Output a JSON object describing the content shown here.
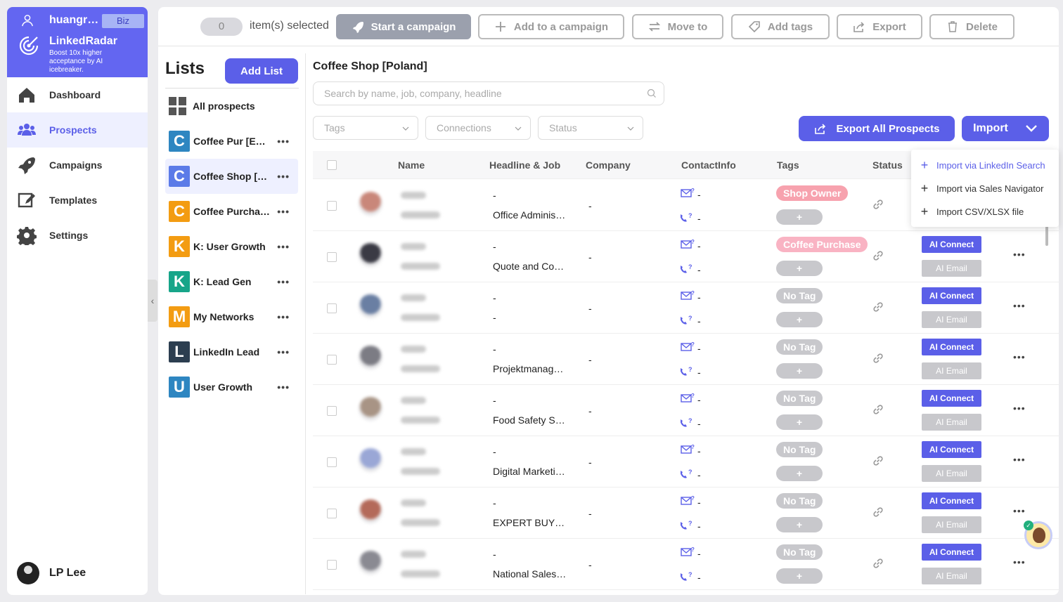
{
  "nav": {
    "username": "huangr…",
    "plan": "Biz",
    "brand": "LinkedRadar",
    "tagline": "Boost 10x higher acceptance by AI icebreaker.",
    "items": [
      {
        "label": "Dashboard"
      },
      {
        "label": "Prospects"
      },
      {
        "label": "Campaigns"
      },
      {
        "label": "Templates"
      },
      {
        "label": "Settings"
      }
    ],
    "footer_user": "LP Lee"
  },
  "toolbar": {
    "selected_count": "0",
    "selected_text": "item(s) selected",
    "start_campaign": "Start a campaign",
    "add_to_campaign": "Add to a campaign",
    "move_to": "Move to",
    "add_tags": "Add tags",
    "export": "Export",
    "delete": "Delete"
  },
  "lists": {
    "title": "Lists",
    "add_label": "Add List",
    "all_prospects": "All prospects",
    "items": [
      {
        "letter": "C",
        "name": "Coffee Pur [E…",
        "color": "#2e86c1"
      },
      {
        "letter": "C",
        "name": "Coffee Shop […",
        "color": "#5b7be8"
      },
      {
        "letter": "C",
        "name": "Coffee Purcha…",
        "color": "#f39c12"
      },
      {
        "letter": "K",
        "name": "K: User Growth",
        "color": "#f39c12"
      },
      {
        "letter": "K",
        "name": "K: Lead Gen",
        "color": "#17a589"
      },
      {
        "letter": "M",
        "name": "My Networks",
        "color": "#f39c12"
      },
      {
        "letter": "L",
        "name": "LinkedIn Lead",
        "color": "#2c3e50"
      },
      {
        "letter": "U",
        "name": "User Growth",
        "color": "#2e86c1"
      }
    ]
  },
  "content": {
    "title": "Coffee Shop [Poland]",
    "search_placeholder": "Search by name, job, company, headline",
    "filters": {
      "tags": "Tags",
      "connections": "Connections",
      "status": "Status"
    },
    "export_all": "Export All Prospects",
    "import": "Import"
  },
  "table": {
    "headers": {
      "name": "Name",
      "headline": "Headline & Job",
      "company": "Company",
      "contact": "ContactInfo",
      "tags": "Tags",
      "status": "Status"
    },
    "rows": [
      {
        "dash": "-",
        "job": "Office Adminis…",
        "company": "-",
        "email": "-",
        "phone": "-",
        "tag": "Shop Owner",
        "tagType": "pink",
        "plus": "+",
        "ai_connect": "",
        "ai_email": "",
        "avatarColor": "#c9877a"
      },
      {
        "dash": "-",
        "job": "Quote and Co…",
        "company": "-",
        "email": "-",
        "phone": "-",
        "tag": "Coffee Purchase",
        "tagType": "pink2",
        "plus": "+",
        "ai_connect": "AI Connect",
        "ai_email": "AI Email",
        "avatarColor": "#3a3a44"
      },
      {
        "dash": "-",
        "job": "-",
        "company": "-",
        "email": "-",
        "phone": "-",
        "tag": "No Tag",
        "tagType": "none",
        "plus": "+",
        "ai_connect": "AI Connect",
        "ai_email": "AI Email",
        "avatarColor": "#6a7fa3"
      },
      {
        "dash": "-",
        "job": "Projektmanag…",
        "company": "-",
        "email": "-",
        "phone": "-",
        "tag": "No Tag",
        "tagType": "none",
        "plus": "+",
        "ai_connect": "AI Connect",
        "ai_email": "AI Email",
        "avatarColor": "#7c7c84"
      },
      {
        "dash": "-",
        "job": "Food Safety S…",
        "company": "-",
        "email": "-",
        "phone": "-",
        "tag": "No Tag",
        "tagType": "none",
        "plus": "+",
        "ai_connect": "AI Connect",
        "ai_email": "AI Email",
        "avatarColor": "#a89485"
      },
      {
        "dash": "-",
        "job": "Digital Marketi…",
        "company": "-",
        "email": "-",
        "phone": "-",
        "tag": "No Tag",
        "tagType": "none",
        "plus": "+",
        "ai_connect": "AI Connect",
        "ai_email": "AI Email",
        "avatarColor": "#9aa7d6"
      },
      {
        "dash": "-",
        "job": "EXPERT BUY…",
        "company": "-",
        "email": "-",
        "phone": "-",
        "tag": "No Tag",
        "tagType": "none",
        "plus": "+",
        "ai_connect": "AI Connect",
        "ai_email": "AI Email",
        "avatarColor": "#b46a5a"
      },
      {
        "dash": "-",
        "job": "National Sales…",
        "company": "-",
        "email": "-",
        "phone": "-",
        "tag": "No Tag",
        "tagType": "none",
        "plus": "+",
        "ai_connect": "AI Connect",
        "ai_email": "AI Email",
        "avatarColor": "#8a8a92"
      }
    ]
  },
  "import_menu": {
    "items": [
      {
        "label": "Import via LinkedIn Search"
      },
      {
        "label": "Import via Sales Navigator"
      },
      {
        "label": "Import CSV/XLSX file"
      }
    ]
  }
}
